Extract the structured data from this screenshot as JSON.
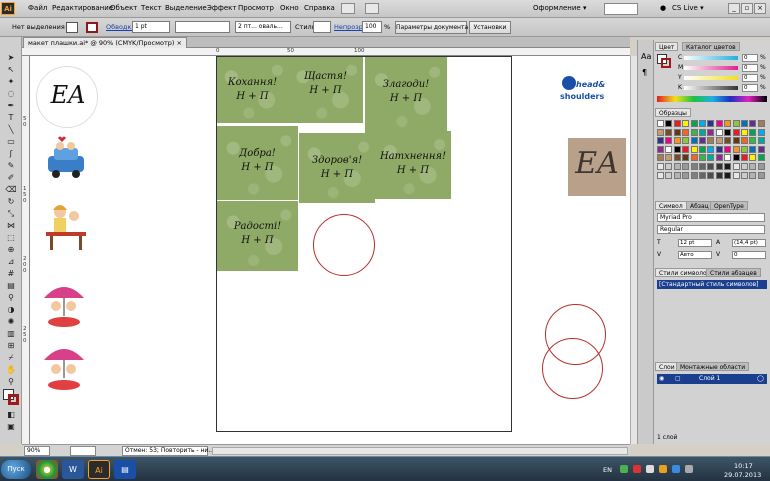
{
  "app": {
    "logo": "Ai",
    "name": "Adobe Illustrator CS5"
  },
  "menu": [
    "Файл",
    "Редактирование",
    "Объект",
    "Текст",
    "Выделение",
    "Эффект",
    "Просмотр",
    "Окно",
    "Справка"
  ],
  "workspace": {
    "label": "Оформление ▾",
    "cs_live": "CS Live ▾"
  },
  "control": {
    "selection": "Нет выделения",
    "stroke_label": "Обводка:",
    "stroke_weight": "1 pt",
    "brush": "2 пт... оваль...",
    "style_label": "Стиль:",
    "opacity_label": "Непрозр.:",
    "opacity_value": "100",
    "opacity_unit": "%",
    "doc_settings": "Параметры документа",
    "preferences": "Установки"
  },
  "document": {
    "tab_title": "макет плашки.ai* @ 90% (CMYK/Просмотр)"
  },
  "ruler": {
    "zero": "0",
    "fifty": "50",
    "hundred": "100",
    "left_marks": [
      "5",
      "0",
      "1",
      "5",
      "0",
      "2",
      "0",
      "0",
      "2",
      "5",
      "0"
    ]
  },
  "cards": [
    {
      "line1": "Кохання!",
      "line2": "Н + П"
    },
    {
      "line1": "Щастя!",
      "line2": "Н + П"
    },
    {
      "line1": "Злагоди!",
      "line2": "Н + П"
    },
    {
      "line1": "Добра!",
      "line2": "Н + П"
    },
    {
      "line1": "Здоров'я!",
      "line2": "Н + П"
    },
    {
      "line1": "Натхнення!",
      "line2": "Н + П"
    },
    {
      "line1": "Радості!",
      "line2": "Н + П"
    }
  ],
  "monogram": "EA",
  "logo_text": {
    "line1": "head&",
    "line2": "shoulders"
  },
  "statusbar": {
    "zoom": "90%",
    "status": "Отмен: 53; Повторить - ни..."
  },
  "panels": {
    "color_tabs": [
      "Цвет",
      "Каталог цветов"
    ],
    "cmyk": [
      {
        "label": "C",
        "value": "0",
        "unit": "%",
        "color": "#20b0e0"
      },
      {
        "label": "M",
        "value": "0",
        "unit": "%",
        "color": "#e0208a"
      },
      {
        "label": "Y",
        "value": "0",
        "unit": "%",
        "color": "#f0e020"
      },
      {
        "label": "K",
        "value": "0",
        "unit": "%",
        "color": "#333333"
      }
    ],
    "swatches_title": "Образцы",
    "char_tabs": [
      "Символ",
      "Абзац",
      "OpenType"
    ],
    "font_family": "Myriad Pro",
    "font_style": "Regular",
    "font_size": "12 pt",
    "leading": "(14,4 pt)",
    "tracking_auto": "Авто",
    "tracking": "0",
    "char_styles_tabs": [
      "Стили символов",
      "Стили абзацев"
    ],
    "char_style_selected": "[Стандартный стиль символов]",
    "layer_tabs": [
      "Слои",
      "Монтажные области"
    ],
    "layer_name": "Слой 1",
    "layer_count": "1 слой"
  },
  "taskbar": {
    "start": "Пуск",
    "lang": "EN",
    "time": "10:17",
    "date": "29.07.2013"
  }
}
